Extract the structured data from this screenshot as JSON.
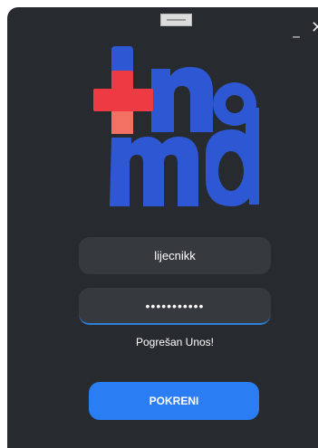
{
  "window": {
    "minimize_label": "_",
    "close_label": "✕"
  },
  "logo": {
    "icon": "inomd-medical-logo",
    "brand_text": "inomd",
    "colors": {
      "blue": "#2d57d3",
      "red": "#ee3b43"
    }
  },
  "login": {
    "username_value": "lijecnikk",
    "password_value": "•••••••••••",
    "error_message": "Pogrešan Unos!",
    "submit_label": "POKRENI"
  },
  "colors": {
    "background": "#272a2e",
    "field": "#36393d",
    "accent": "#2a7df2"
  }
}
